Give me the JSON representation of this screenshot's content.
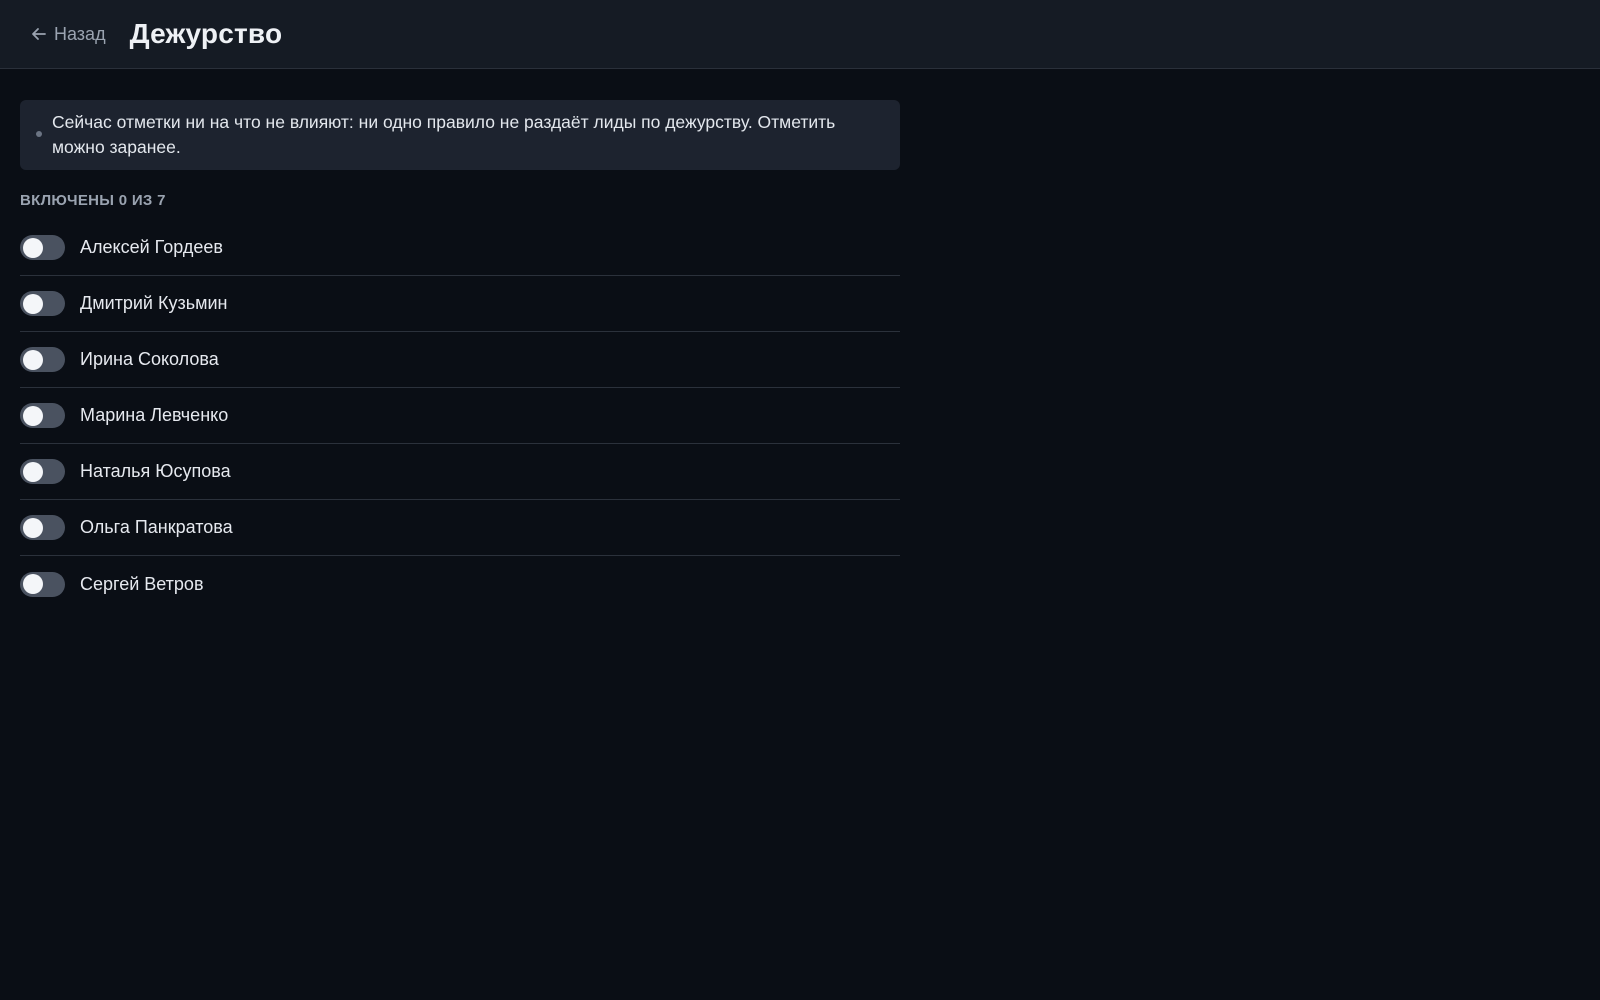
{
  "header": {
    "back_label": "Назад",
    "title": "Дежурство"
  },
  "notice": {
    "text": "Сейчас отметки ни на что не влияют: ни одно правило не раздаёт лиды по дежурству. Отметить можно заранее."
  },
  "counter": {
    "label": "ВКЛЮЧЕНЫ 0 ИЗ 7"
  },
  "people": [
    {
      "name": "Алексей Гордеев",
      "enabled": false
    },
    {
      "name": "Дмитрий Кузьмин",
      "enabled": false
    },
    {
      "name": "Ирина Соколова",
      "enabled": false
    },
    {
      "name": "Марина Левченко",
      "enabled": false
    },
    {
      "name": "Наталья Юсупова",
      "enabled": false
    },
    {
      "name": "Ольга Панкратова",
      "enabled": false
    },
    {
      "name": "Сергей Ветров",
      "enabled": false
    }
  ]
}
